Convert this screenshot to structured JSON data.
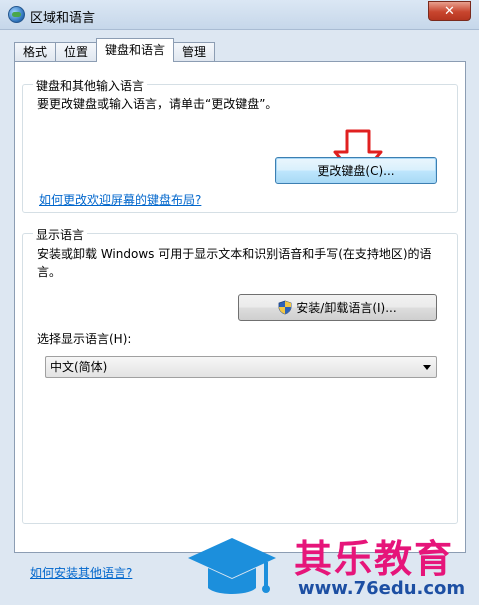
{
  "window": {
    "title": "区域和语言",
    "close_glyph": "✕"
  },
  "tabs": [
    {
      "label": "格式"
    },
    {
      "label": "位置"
    },
    {
      "label": "键盘和语言",
      "active": true
    },
    {
      "label": "管理"
    }
  ],
  "keyboard_group": {
    "legend": "键盘和其他输入语言",
    "description": "要更改键盘或输入语言，请单击“更改键盘”。",
    "change_button": "更改键盘(C)...",
    "welcome_link": "如何更改欢迎屏幕的键盘布局?"
  },
  "display_group": {
    "legend": "显示语言",
    "description": "安装或卸载 Windows 可用于显示文本和识别语音和手写(在支持地区)的语言。",
    "install_button": "安装/卸载语言(I)...",
    "select_label": "选择显示语言(H):",
    "selected_language": "中文(简体)"
  },
  "bottom_link": "如何安装其他语言?",
  "watermark": {
    "brand": "其乐教育",
    "url": "www.76edu.com"
  },
  "icons": {
    "app": "globe-icon",
    "shield": "uac-shield-icon",
    "arrow": "red-down-arrow-icon"
  },
  "colors": {
    "link": "#0066cc",
    "arrow": "#e02020",
    "watermark_brand": "#e6157a",
    "watermark_url": "#1d4fa3"
  }
}
